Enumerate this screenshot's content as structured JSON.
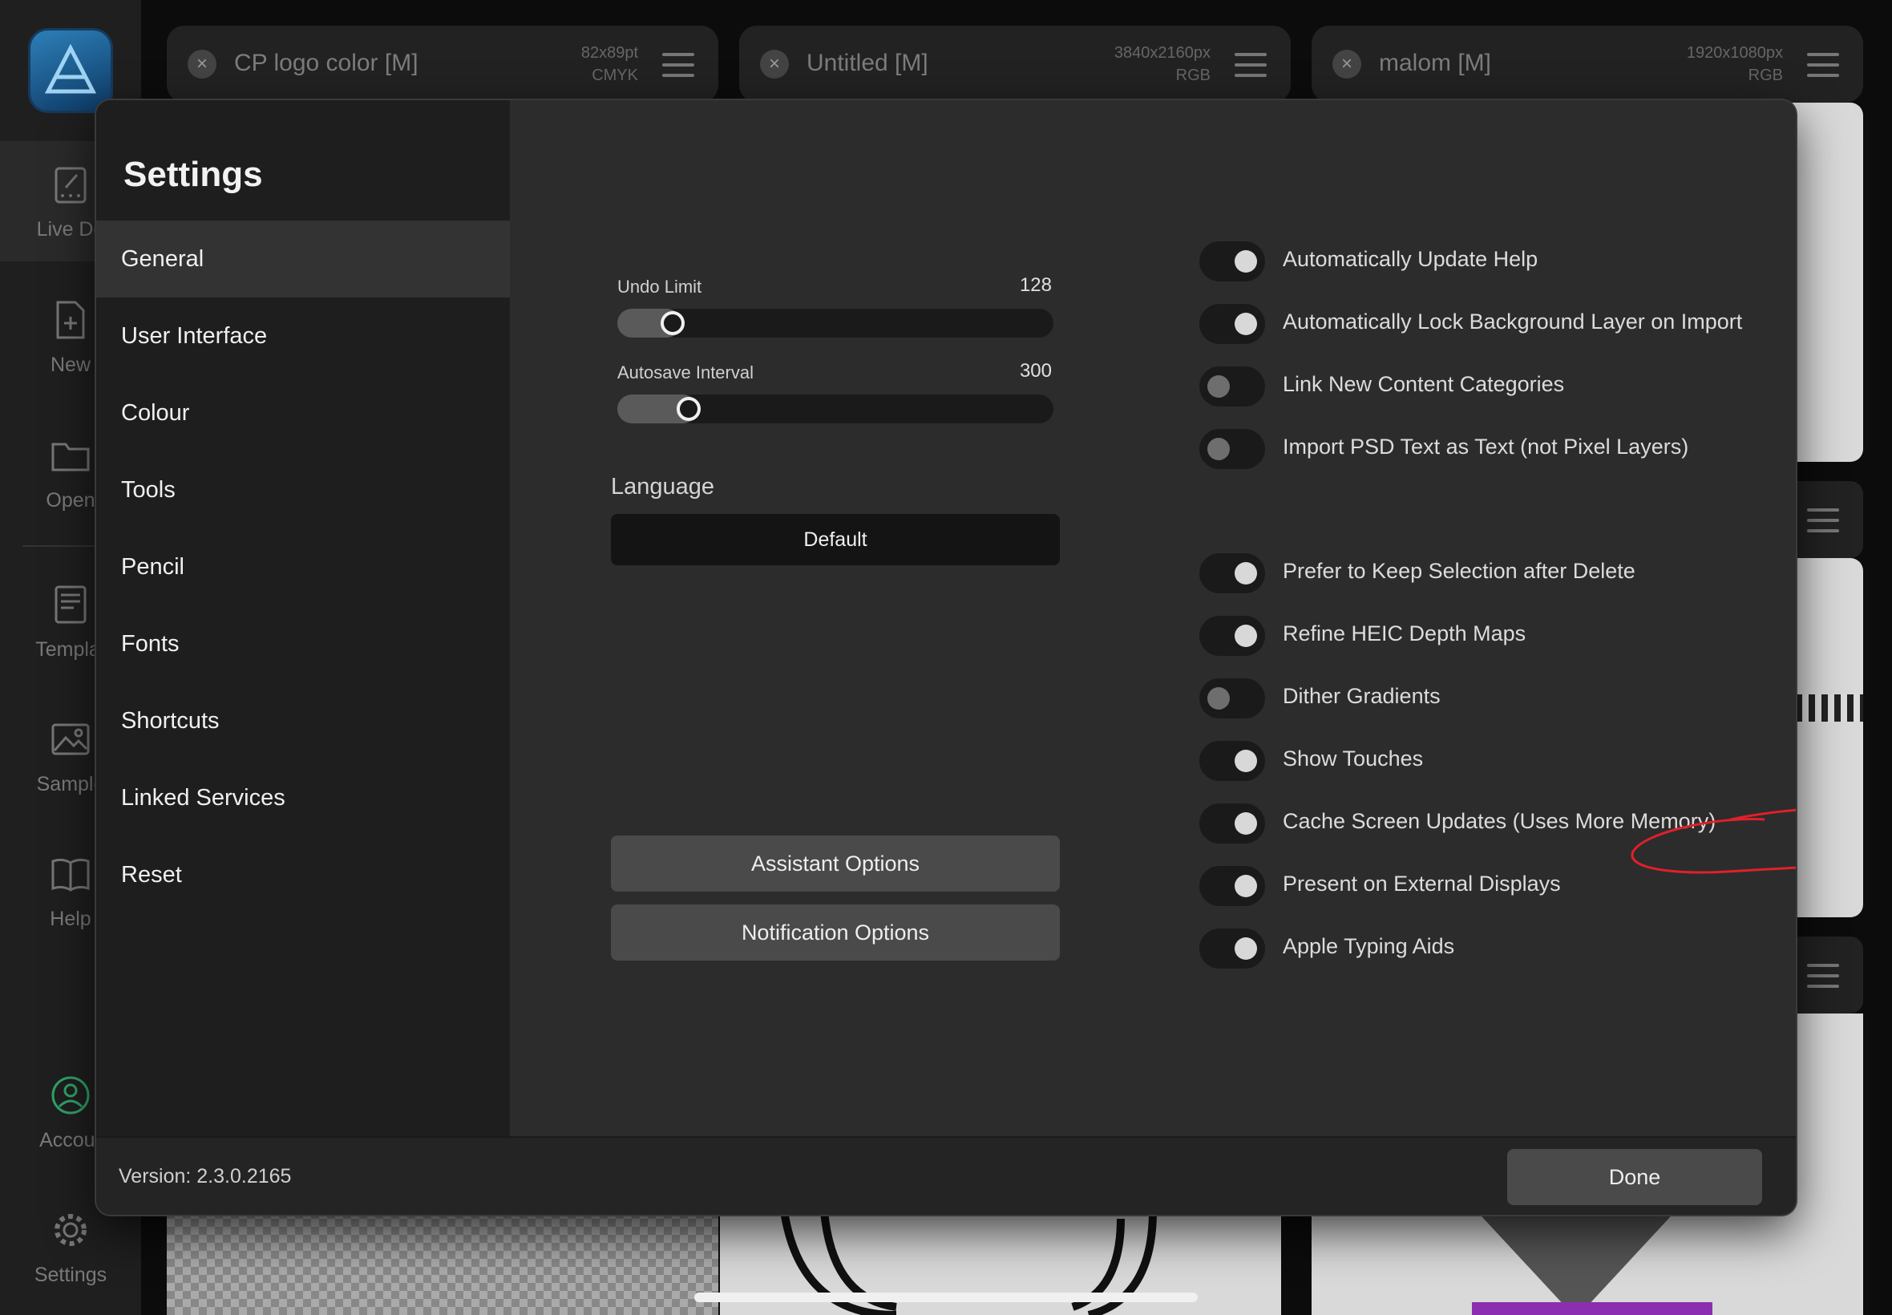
{
  "sidebar": {
    "items": [
      {
        "label": "Live Do",
        "icon": "live-document-icon"
      },
      {
        "label": "New",
        "icon": "new-document-icon"
      },
      {
        "label": "Open",
        "icon": "folder-icon"
      },
      {
        "label": "Templat",
        "icon": "template-icon"
      },
      {
        "label": "Sample",
        "icon": "image-icon"
      },
      {
        "label": "Help",
        "icon": "book-icon"
      },
      {
        "label": "Accour",
        "icon": "account-icon"
      },
      {
        "label": "Settings",
        "icon": "gear-icon"
      }
    ]
  },
  "documents": [
    {
      "name": "CP logo color [M]",
      "size": "82x89pt",
      "mode": "CMYK"
    },
    {
      "name": "Untitled [M]",
      "size": "3840x2160px",
      "mode": "RGB"
    },
    {
      "name": "malom [M]",
      "size": "1920x1080px",
      "mode": "RGB"
    }
  ],
  "settings": {
    "title": "Settings",
    "nav": [
      "General",
      "User Interface",
      "Colour",
      "Tools",
      "Pencil",
      "Fonts",
      "Shortcuts",
      "Linked Services",
      "Reset"
    ],
    "active_nav": "General",
    "undo_limit": {
      "label": "Undo Limit",
      "value": "128",
      "fraction": 0.08
    },
    "autosave": {
      "label": "Autosave Interval",
      "value": "300",
      "fraction": 0.12
    },
    "language": {
      "label": "Language",
      "value": "Default"
    },
    "assistant_button": "Assistant Options",
    "notification_button": "Notification Options",
    "toggles": [
      {
        "label": "Automatically Update Help",
        "on": true
      },
      {
        "label": "Automatically Lock Background Layer on Import",
        "on": true
      },
      {
        "label": "Link New Content Categories",
        "on": false
      },
      {
        "label": "Import PSD Text as Text (not Pixel Layers)",
        "on": false
      },
      {
        "label": "Prefer to Keep Selection after Delete",
        "on": true
      },
      {
        "label": "Refine HEIC Depth Maps",
        "on": true
      },
      {
        "label": "Dither Gradients",
        "on": false
      },
      {
        "label": "Show Touches",
        "on": true
      },
      {
        "label": "Cache Screen Updates (Uses More Memory)",
        "on": true
      },
      {
        "label": "Present on External Displays",
        "on": true
      },
      {
        "label": "Apple Typing Aids",
        "on": true
      }
    ],
    "annotation_color": "#e0202a",
    "version": "Version: 2.3.0.2165",
    "done_button": "Done"
  }
}
